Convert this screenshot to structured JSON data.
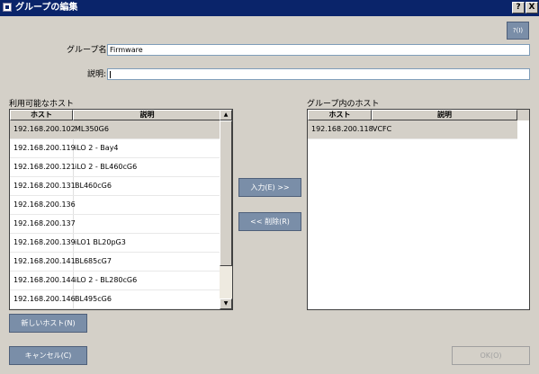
{
  "window": {
    "title": "グループの編集",
    "help_label": "?",
    "close_label": "X"
  },
  "form": {
    "group_name_label": "グループ名:",
    "group_name_value": "Firmware",
    "description_label": "説明:",
    "description_value": ""
  },
  "available": {
    "title": "利用可能なホスト",
    "columns": [
      "ホスト",
      "説明"
    ],
    "rows": [
      {
        "host": "192.168.200.102",
        "desc": "ML350G6"
      },
      {
        "host": "192.168.200.119",
        "desc": "iLO 2 - Bay4"
      },
      {
        "host": "192.168.200.121",
        "desc": "iLO 2 - BL460cG6"
      },
      {
        "host": "192.168.200.131",
        "desc": "BL460cG6"
      },
      {
        "host": "192.168.200.136",
        "desc": ""
      },
      {
        "host": "192.168.200.137",
        "desc": ""
      },
      {
        "host": "192.168.200.139",
        "desc": "iLO1 BL20pG3"
      },
      {
        "host": "192.168.200.141",
        "desc": "BL685cG7"
      },
      {
        "host": "192.168.200.144",
        "desc": "iLO 2 - BL280cG6"
      },
      {
        "host": "192.168.200.146",
        "desc": "BL495cG6"
      }
    ]
  },
  "ingroup": {
    "title": "グループ内のホスト",
    "columns": [
      "ホスト",
      "説明"
    ],
    "rows": [
      {
        "host": "192.168.200.118",
        "desc": "VCFC"
      }
    ]
  },
  "buttons": {
    "add": "入力(E) >>",
    "remove": "<< 削除(R)",
    "new_host": "新しいホスト(N)",
    "cancel": "キャンセル(C)",
    "ok": "OK(O)",
    "icon_text": "?(I)"
  },
  "colors": {
    "titlebar": "#0a246a",
    "button": "#7a8ea8",
    "window": "#d4d0c8"
  }
}
